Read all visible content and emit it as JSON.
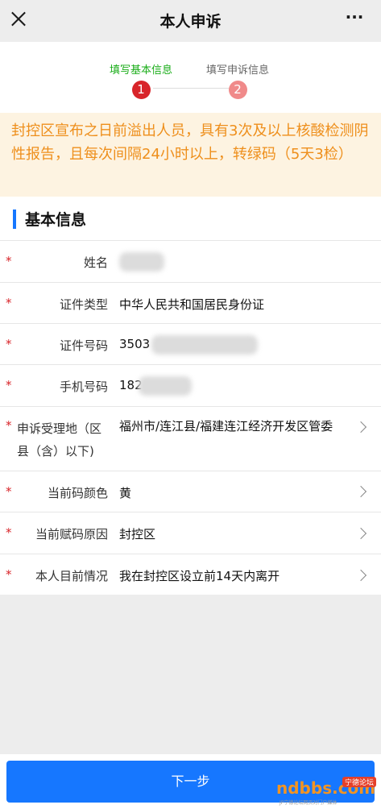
{
  "header": {
    "title": "本人申诉",
    "more_label": "···"
  },
  "steps": [
    {
      "label": "填写基本信息",
      "number": "1"
    },
    {
      "label": "填写申诉信息",
      "number": "2"
    }
  ],
  "notice": "封控区宣布之日前溢出人员，具有3次及以上核酸检测阴性报告，且每次间隔24小时以上，转绿码（5天3检）",
  "section_title": "基本信息",
  "required_mark": "*",
  "fields": [
    {
      "label": "姓名",
      "value": ""
    },
    {
      "label": "证件类型",
      "value": "中华人民共和国居民身份证"
    },
    {
      "label": "证件号码",
      "value": "3503"
    },
    {
      "label": "手机号码",
      "value": "182"
    },
    {
      "label": "申诉受理地（区县（含）以下)",
      "value": "福州市/连江县/福建连江经济开发区管委"
    },
    {
      "label": "当前码颜色",
      "value": "黄"
    },
    {
      "label": "当前赋码原因",
      "value": "封控区"
    },
    {
      "label": "本人目前情况",
      "value": "我在封控区设立前14天内离开"
    }
  ],
  "next_button": "下一步",
  "watermark": {
    "text": "ndbbs.com",
    "badge": "宁德论坛",
    "subtext": "JP宁德论坛网页对门户媒体"
  },
  "colors": {
    "primary": "#1677ff",
    "active_step": "#1aad19",
    "required": "#d8252a",
    "notice_text": "#ee8f1c",
    "notice_bg": "#fdf3e1"
  }
}
